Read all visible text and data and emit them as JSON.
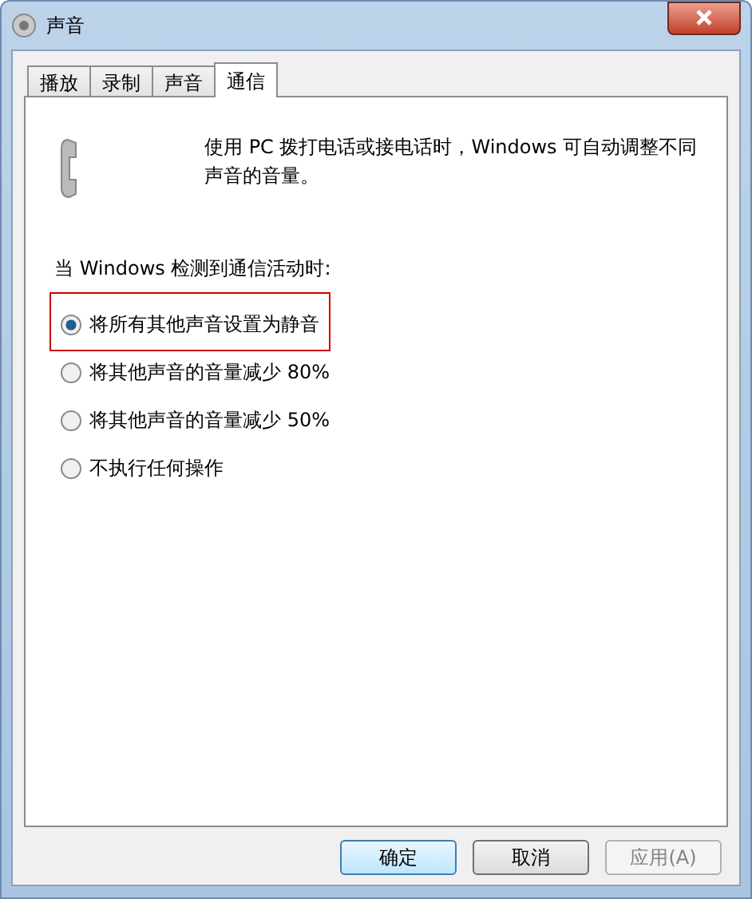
{
  "window": {
    "title": "声音"
  },
  "tabs": [
    {
      "label": "播放",
      "selected": false
    },
    {
      "label": "录制",
      "selected": false
    },
    {
      "label": "声音",
      "selected": false
    },
    {
      "label": "通信",
      "selected": true
    }
  ],
  "description": "使用 PC 拨打电话或接电话时，Windows 可自动调整不同声音的音量。",
  "prompt": "当 Windows 检测到通信活动时:",
  "options": [
    {
      "label": "将所有其他声音设置为静音",
      "selected": true,
      "highlighted": true
    },
    {
      "label": "将其他声音的音量减少 80%",
      "selected": false,
      "highlighted": false
    },
    {
      "label": "将其他声音的音量减少 50%",
      "selected": false,
      "highlighted": false
    },
    {
      "label": "不执行任何操作",
      "selected": false,
      "highlighted": false
    }
  ],
  "buttons": [
    {
      "label": "确定",
      "default": true,
      "disabled": false
    },
    {
      "label": "取消",
      "default": false,
      "disabled": false
    },
    {
      "label": "应用(A)",
      "default": false,
      "disabled": true
    }
  ]
}
